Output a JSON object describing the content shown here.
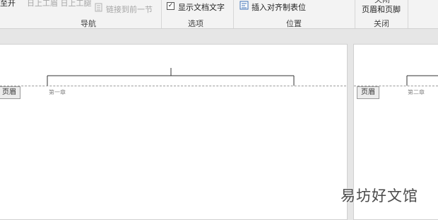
{
  "ribbon": {
    "partial_top_left": "至开",
    "partial_prev_next": "日上工眉 日上工腿",
    "link_to_previous": "链接到前一节",
    "show_document_text": "显示文档文字",
    "show_document_text_checked": true,
    "insert_alignment_tab": "插入对齐制表位",
    "close_header_footer": "页眉和页脚",
    "close_top_partial": "关闭",
    "groups": {
      "navigation": "导航",
      "options": "选项",
      "position": "位置",
      "close": "关闭"
    }
  },
  "pages": [
    {
      "header_tab": "页眉",
      "chapter_label": "第一章"
    },
    {
      "header_tab": "页眉",
      "chapter_label": "第二章"
    }
  ],
  "watermark": "易坊好文馆"
}
